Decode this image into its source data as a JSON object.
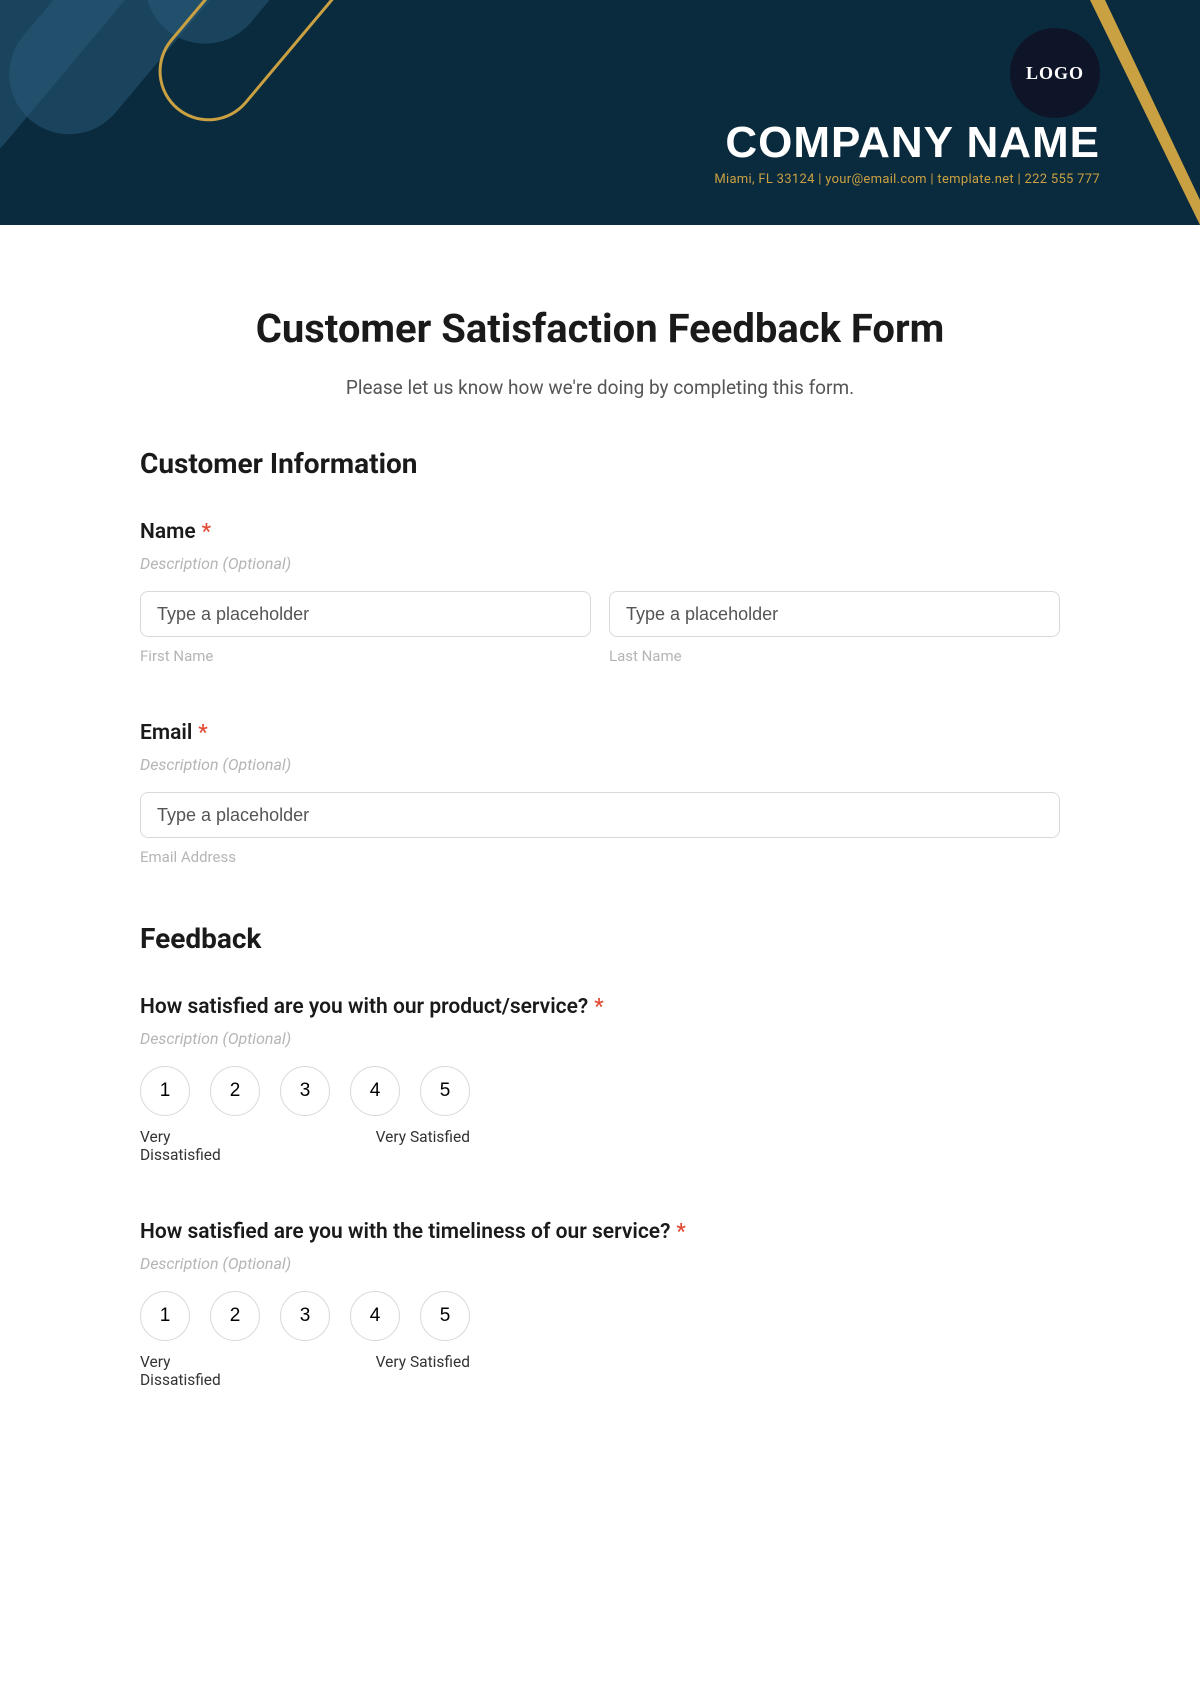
{
  "header": {
    "logo_text": "LOGO",
    "company_name": "COMPANY NAME",
    "contact_line": "Miami, FL 33124 | your@email.com | template.net | 222 555 777"
  },
  "form": {
    "title": "Customer Satisfaction Feedback Form",
    "subtitle": "Please let us know how we're doing by completing this form."
  },
  "sections": {
    "customer_info": {
      "heading": "Customer Information",
      "name": {
        "label": "Name",
        "required_marker": "*",
        "description": "Description (Optional)",
        "first_placeholder": "Type a placeholder",
        "first_sublabel": "First Name",
        "last_placeholder": "Type a placeholder",
        "last_sublabel": "Last Name"
      },
      "email": {
        "label": "Email",
        "required_marker": "*",
        "description": "Description (Optional)",
        "placeholder": "Type a placeholder",
        "sublabel": "Email Address"
      }
    },
    "feedback": {
      "heading": "Feedback",
      "q1": {
        "label": "How satisfied are you with our product/service?",
        "required_marker": "*",
        "description": "Description (Optional)",
        "options": [
          "1",
          "2",
          "3",
          "4",
          "5"
        ],
        "anchor_low": "Very Dissatisfied",
        "anchor_high": "Very Satisfied"
      },
      "q2": {
        "label": "How satisfied are you with the timeliness of our service?",
        "required_marker": "*",
        "description": "Description (Optional)",
        "options": [
          "1",
          "2",
          "3",
          "4",
          "5"
        ],
        "anchor_low": "Very Dissatisfied",
        "anchor_high": "Very Satisfied"
      }
    }
  }
}
